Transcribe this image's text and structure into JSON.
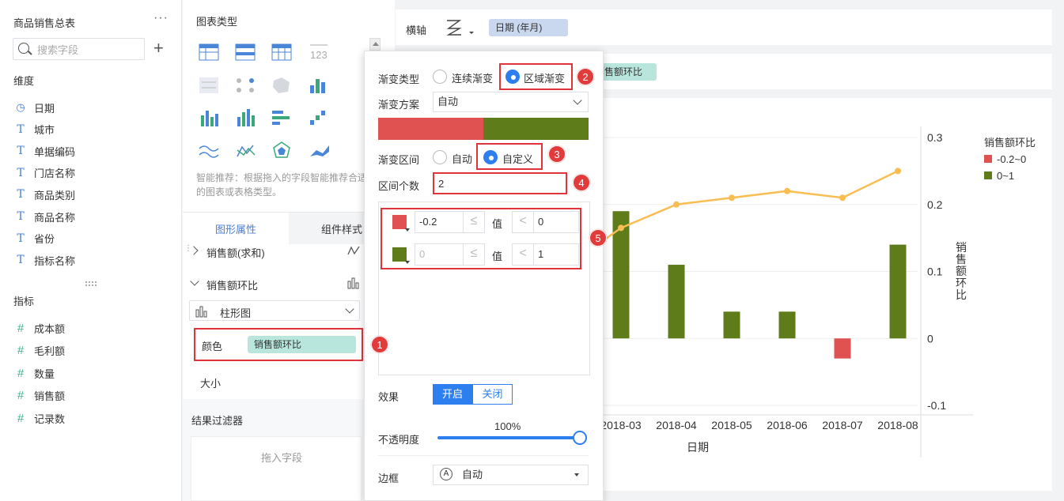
{
  "left_panel": {
    "title": "商品销售总表",
    "more": "···",
    "search_placeholder": "搜索字段",
    "dimensions_title": "维度",
    "dimensions": [
      {
        "label": "日期",
        "icon": "clock-icon"
      },
      {
        "label": "城市",
        "icon": "text-type-icon"
      },
      {
        "label": "单据编码",
        "icon": "text-type-icon"
      },
      {
        "label": "门店名称",
        "icon": "text-type-icon"
      },
      {
        "label": "商品类别",
        "icon": "text-type-icon"
      },
      {
        "label": "商品名称",
        "icon": "text-type-icon"
      },
      {
        "label": "省份",
        "icon": "text-type-icon"
      },
      {
        "label": "指标名称",
        "icon": "text-type-icon"
      }
    ],
    "measures_title": "指标",
    "measures": [
      {
        "label": "成本额",
        "icon": "hash-icon"
      },
      {
        "label": "毛利额",
        "icon": "hash-icon"
      },
      {
        "label": "数量",
        "icon": "hash-icon"
      },
      {
        "label": "销售额",
        "icon": "hash-icon"
      },
      {
        "label": "记录数",
        "icon": "hash-icon"
      }
    ]
  },
  "chart_types": {
    "title": "图表类型",
    "hint": "智能推荐：根据拖入的字段智能推荐合适的图表或表格类型。"
  },
  "attributes": {
    "tab_shape": "图形属性",
    "tab_component": "组件样式",
    "item_sales": "销售额(求和)",
    "item_ratio": "销售额环比",
    "chart_type_select": "柱形图",
    "color_label": "颜色",
    "color_field": "销售额环比",
    "size_label": "大小",
    "filter_title": "结果过滤器",
    "filter_drop": "拖入字段"
  },
  "axis_bar": {
    "label": "横轴",
    "field": "日期 (年月)",
    "second_field": "销售额环比"
  },
  "popup": {
    "gradient_type_label": "渐变类型",
    "gradient_continuous": "连续渐变",
    "gradient_region": "区域渐变",
    "scheme_label": "渐变方案",
    "scheme_value": "自动",
    "interval_label": "渐变区间",
    "interval_auto": "自动",
    "interval_custom": "自定义",
    "count_label": "区间个数",
    "count_value": "2",
    "ranges": [
      {
        "color": "#e05252",
        "from": "-0.2",
        "op1": "≤",
        "val_label": "值",
        "op2": "<",
        "to": "0"
      },
      {
        "color": "#5e7d1a",
        "from": "0",
        "op1": "≤",
        "val_label": "值",
        "op2": "<",
        "to": "1"
      }
    ],
    "effect_label": "效果",
    "effect_on": "开启",
    "effect_off": "关闭",
    "opacity_label": "不透明度",
    "opacity_value": "100%",
    "border_label": "边框",
    "border_value": "自动",
    "scheme_colors": [
      "#e05252",
      "#5e7d1a"
    ]
  },
  "badges": [
    "1",
    "2",
    "3",
    "4",
    "5"
  ],
  "chart_data": {
    "type": "bar",
    "categories": [
      "2018-03",
      "2018-04",
      "2018-05",
      "2018-06",
      "2018-07",
      "2018-08"
    ],
    "x_tick_visible_partial": "2018-03",
    "xlabel": "日期",
    "ylabel_right": "销售额环比",
    "right_ticks": [
      "0.3",
      "0.2",
      "0.1",
      "0",
      "-0.1"
    ],
    "ylim": [
      -0.1,
      0.3
    ],
    "series": [
      {
        "name": "销售额环比",
        "type": "bar",
        "values": [
          0.19,
          0.11,
          0.04,
          0.04,
          -0.03,
          0.14
        ]
      },
      {
        "type": "line",
        "values": [
          0.165,
          0.2,
          0.21,
          0.22,
          0.21,
          0.25
        ],
        "color": "#f9bd52"
      }
    ],
    "legend": {
      "title": "销售额环比",
      "items": [
        {
          "label": "-0.2~0",
          "color": "#e05252"
        },
        {
          "label": "0~1",
          "color": "#5e7d1a"
        }
      ],
      "position": "top-right"
    }
  }
}
